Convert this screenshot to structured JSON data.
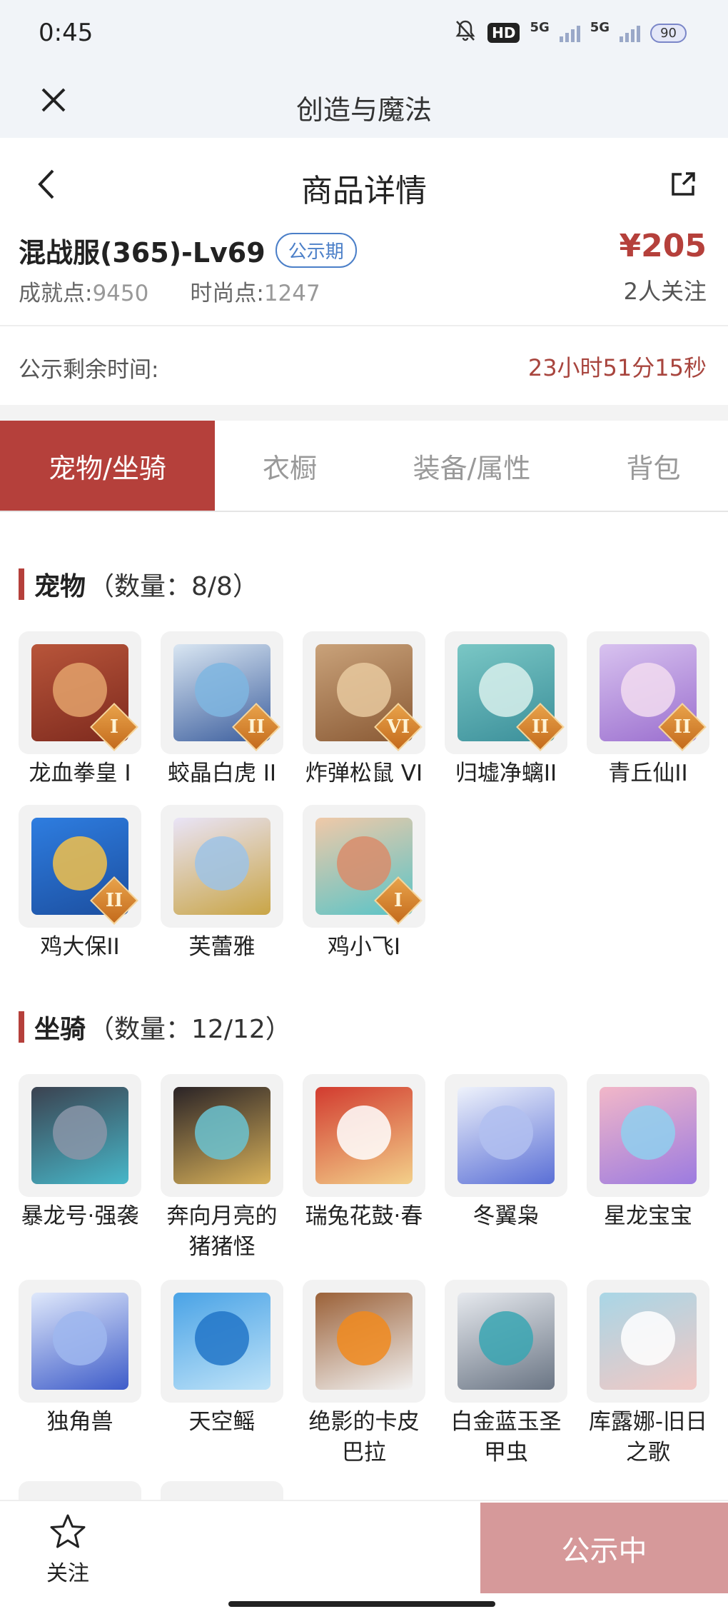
{
  "status_bar": {
    "time": "0:45",
    "hd": "HD",
    "net1": "5G",
    "net2": "5G",
    "battery": "90"
  },
  "app_bar": {
    "title": "创造与魔法"
  },
  "page_bar": {
    "title": "商品详情"
  },
  "product": {
    "name": "混战服(365)-Lv69",
    "badge": "公示期",
    "achievement_label": "成就点:",
    "achievement_value": "9450",
    "fashion_label": "时尚点:",
    "fashion_value": "1247",
    "price": "¥205",
    "watchers": "2人关注"
  },
  "timer": {
    "label": "公示剩余时间:",
    "value": "23小时51分15秒"
  },
  "tabs": [
    {
      "label": "宠物/坐骑"
    },
    {
      "label": "衣橱"
    },
    {
      "label": "装备/属性"
    },
    {
      "label": "背包"
    }
  ],
  "pets": {
    "title": "宠物",
    "count": "（数量：8/8）",
    "items": [
      {
        "label": "龙血拳皇 I",
        "rank": "I",
        "icon": "red-demon-avatar"
      },
      {
        "label": "蛟晶白虎 II",
        "rank": "II",
        "icon": "white-tiger-avatar"
      },
      {
        "label": "炸弹松鼠 VI",
        "rank": "VI",
        "icon": "squirrel-avatar"
      },
      {
        "label": "归墟净螭II",
        "rank": "II",
        "icon": "jade-dragon-avatar"
      },
      {
        "label": "青丘仙II",
        "rank": "II",
        "icon": "fox-fairy-avatar"
      },
      {
        "label": "鸡大保II",
        "rank": "II",
        "icon": "blue-chicken-avatar"
      },
      {
        "label": "芙蕾雅",
        "rank": "",
        "icon": "freya-avatar"
      },
      {
        "label": "鸡小飞I",
        "rank": "I",
        "icon": "muscle-chick-avatar"
      }
    ]
  },
  "mounts": {
    "title": "坐骑",
    "count": "（数量：12/12）",
    "items": [
      {
        "label": "暴龙号·强袭",
        "icon": "mecha-dragon-avatar"
      },
      {
        "label": "奔向月亮的猪猪怪",
        "icon": "pig-avatar"
      },
      {
        "label": "瑞兔花鼓·春",
        "icon": "rabbit-drum-avatar"
      },
      {
        "label": "冬翼枭",
        "icon": "snow-owl-avatar"
      },
      {
        "label": "星龙宝宝",
        "icon": "star-dragon-avatar"
      },
      {
        "label": "独角兽",
        "icon": "unicorn-avatar"
      },
      {
        "label": "天空鳐",
        "icon": "sky-ray-avatar"
      },
      {
        "label": "绝影的卡皮巴拉",
        "icon": "capybara-avatar"
      },
      {
        "label": "白金蓝玉圣甲虫",
        "icon": "beetle-avatar"
      },
      {
        "label": "库露娜-旧日之歌",
        "icon": "sheep-girl-avatar"
      }
    ]
  },
  "bottom_bar": {
    "follow": "关注",
    "status": "公示中"
  },
  "colors": {
    "accent": "#b5403b",
    "badge": "#4b7fc8",
    "status_button": "#d6999a"
  }
}
